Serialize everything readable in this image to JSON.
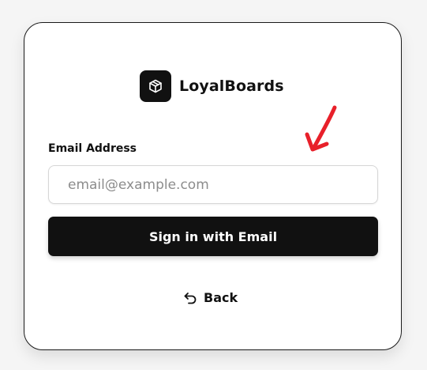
{
  "brand": {
    "name": "LoyalBoards",
    "logo_icon": "box-icon"
  },
  "form": {
    "email_label": "Email Address",
    "email_placeholder": "email@example.com",
    "email_value": "",
    "submit_label": "Sign in with Email"
  },
  "back": {
    "label": "Back",
    "icon": "undo-arrow-icon"
  },
  "annotation": {
    "icon": "red-arrow-annotation",
    "color": "#e8202a"
  },
  "colors": {
    "primary": "#111111",
    "background": "#f5f5f5",
    "card": "#ffffff"
  }
}
